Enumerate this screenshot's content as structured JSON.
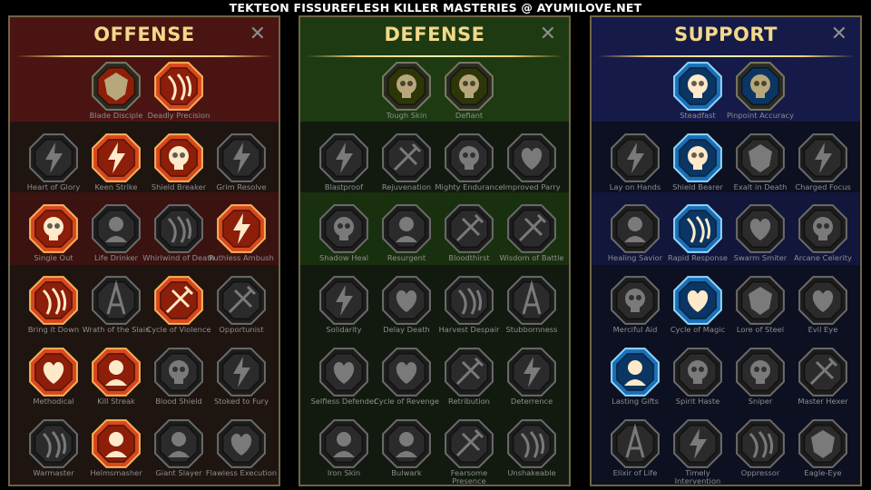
{
  "banner": "TEKTEON FISSUREFLESH KILLER MASTERIES @ AYUMILOVE.NET",
  "close_glyph": "✕",
  "panels": [
    {
      "title": "OFFENSE",
      "theme": {
        "bg_dark": "#1e1410",
        "band": "#4a1412",
        "band2": "#3a1210",
        "lit_fill": "#d9471c",
        "lit_inner": "#8c1e0a",
        "lit_ring": "#f7b25a"
      },
      "rows": [
        [
          {
            "label": "Blade Disciple",
            "icon": "crossed-swords-icon",
            "state": "half"
          },
          {
            "label": "Deadly Precision",
            "icon": "dagger-icon",
            "state": "lit"
          }
        ],
        [
          {
            "label": "Heart of Glory",
            "icon": "horned-warrior-icon",
            "state": "off"
          },
          {
            "label": "Keen Strike",
            "icon": "claw-slash-icon",
            "state": "lit"
          },
          {
            "label": "Shield Breaker",
            "icon": "broken-shield-icon",
            "state": "lit"
          },
          {
            "label": "Grim Resolve",
            "icon": "dark-heart-icon",
            "state": "off"
          }
        ],
        [
          {
            "label": "Single Out",
            "icon": "pointing-hands-icon",
            "state": "lit"
          },
          {
            "label": "Life Drinker",
            "icon": "fanged-mouth-icon",
            "state": "off"
          },
          {
            "label": "Whirlwind of Death",
            "icon": "skull-whirl-icon",
            "state": "off"
          },
          {
            "label": "Ruthless Ambush",
            "icon": "fist-blade-icon",
            "state": "lit"
          }
        ],
        [
          {
            "label": "Bring it Down",
            "icon": "sword-down-icon",
            "state": "lit"
          },
          {
            "label": "Wrath of the Slain",
            "icon": "hammer-fist-icon",
            "state": "off"
          },
          {
            "label": "Cycle of Violence",
            "icon": "axe-icon",
            "state": "lit"
          },
          {
            "label": "Opportunist",
            "icon": "chain-lightning-icon",
            "state": "off"
          }
        ],
        [
          {
            "label": "Methodical",
            "icon": "burst-icon",
            "state": "lit"
          },
          {
            "label": "Kill Streak",
            "icon": "skull-icon",
            "state": "lit"
          },
          {
            "label": "Blood Shield",
            "icon": "sword-shield-icon",
            "state": "off"
          },
          {
            "label": "Stoked to Fury",
            "icon": "raging-figure-icon",
            "state": "off"
          }
        ],
        [
          {
            "label": "Warmaster",
            "icon": "sword-star-icon",
            "state": "off"
          },
          {
            "label": "Helmsmasher",
            "icon": "helmet-icon",
            "state": "lit"
          },
          {
            "label": "Giant Slayer",
            "icon": "giant-icon",
            "state": "off"
          },
          {
            "label": "Flawless Execution",
            "icon": "execution-icon",
            "state": "off"
          }
        ]
      ]
    },
    {
      "title": "DEFENSE",
      "theme": {
        "bg_dark": "#121a10",
        "band": "#1d3a12",
        "band2": "#19300f",
        "lit_fill": "#6a7a14",
        "lit_inner": "#2c3608",
        "lit_ring": "#c5d24a"
      },
      "rows": [
        [
          {
            "label": "Tough Skin",
            "icon": "scales-icon",
            "state": "half"
          },
          {
            "label": "Defiant",
            "icon": "raised-fist-icon",
            "state": "half"
          }
        ],
        [
          {
            "label": "Blastproof",
            "icon": "armor-icon",
            "state": "off"
          },
          {
            "label": "Rejuvenation",
            "icon": "hand-heal-icon",
            "state": "off"
          },
          {
            "label": "Mighty Endurance",
            "icon": "muscle-icon",
            "state": "off"
          },
          {
            "label": "Improved Parry",
            "icon": "parry-blades-icon",
            "state": "off"
          }
        ],
        [
          {
            "label": "Shadow Heal",
            "icon": "shadow-figure-icon",
            "state": "off"
          },
          {
            "label": "Resurgent",
            "icon": "knight-icon",
            "state": "off"
          },
          {
            "label": "Bloodthirst",
            "icon": "skull-heart-icon",
            "state": "off"
          },
          {
            "label": "Wisdom of Battle",
            "icon": "hooded-sage-icon",
            "state": "off"
          }
        ],
        [
          {
            "label": "Solidarity",
            "icon": "raised-hands-icon",
            "state": "off"
          },
          {
            "label": "Delay Death",
            "icon": "hourglass-icon",
            "state": "off"
          },
          {
            "label": "Harvest Despair",
            "icon": "open-hand-icon",
            "state": "off"
          },
          {
            "label": "Stubbornness",
            "icon": "bull-icon",
            "state": "off"
          }
        ],
        [
          {
            "label": "Selfless Defender",
            "icon": "runner-icon",
            "state": "off"
          },
          {
            "label": "Cycle of Revenge",
            "icon": "flames-icon",
            "state": "off"
          },
          {
            "label": "Retribution",
            "icon": "spiked-skull-icon",
            "state": "off"
          },
          {
            "label": "Deterrence",
            "icon": "deflect-icon",
            "state": "off"
          }
        ],
        [
          {
            "label": "Iron Skin",
            "icon": "iron-warrior-icon",
            "state": "off"
          },
          {
            "label": "Bulwark",
            "icon": "tower-shield-icon",
            "state": "off"
          },
          {
            "label": "Fearsome Presence",
            "icon": "demon-mask-icon",
            "state": "off"
          },
          {
            "label": "Unshakeable",
            "icon": "strong-figure-icon",
            "state": "off"
          }
        ]
      ]
    },
    {
      "title": "SUPPORT",
      "theme": {
        "bg_dark": "#0c1020",
        "band": "#151a48",
        "band2": "#12163a",
        "lit_fill": "#1a6fb8",
        "lit_inner": "#0b3562",
        "lit_ring": "#8fd8ff"
      },
      "rows": [
        [
          {
            "label": "Steadfast",
            "icon": "heart-plus-icon",
            "state": "lit"
          },
          {
            "label": "Pinpoint Accuracy",
            "icon": "target-icon",
            "state": "half"
          }
        ],
        [
          {
            "label": "Lay on Hands",
            "icon": "praying-hands-icon",
            "state": "off"
          },
          {
            "label": "Shield Bearer",
            "icon": "glowing-shield-icon",
            "state": "lit"
          },
          {
            "label": "Exalt in Death",
            "icon": "smoking-skull-icon",
            "state": "off"
          },
          {
            "label": "Charged Focus",
            "icon": "charged-arm-icon",
            "state": "off"
          }
        ],
        [
          {
            "label": "Healing Savior",
            "icon": "savior-figure-icon",
            "state": "off"
          },
          {
            "label": "Rapid Response",
            "icon": "lightning-icon",
            "state": "lit"
          },
          {
            "label": "Swarm Smiter",
            "icon": "swarm-icon",
            "state": "off"
          },
          {
            "label": "Arcane Celerity",
            "icon": "dashing-figure-icon",
            "state": "off"
          }
        ],
        [
          {
            "label": "Merciful Aid",
            "icon": "chained-heart-icon",
            "state": "off"
          },
          {
            "label": "Cycle of Magic",
            "icon": "comet-icon",
            "state": "lit"
          },
          {
            "label": "Lore of Steel",
            "icon": "open-book-icon",
            "state": "off"
          },
          {
            "label": "Evil Eye",
            "icon": "sunburst-eye-icon",
            "state": "off"
          }
        ],
        [
          {
            "label": "Lasting Gifts",
            "icon": "compass-star-icon",
            "state": "lit"
          },
          {
            "label": "Spirit Haste",
            "icon": "winged-foot-icon",
            "state": "off"
          },
          {
            "label": "Sniper",
            "icon": "eye-icon",
            "state": "off"
          },
          {
            "label": "Master Hexer",
            "icon": "hex-figure-icon",
            "state": "off"
          }
        ],
        [
          {
            "label": "Elixir of Life",
            "icon": "potion-icon",
            "state": "off"
          },
          {
            "label": "Timely Intervention",
            "icon": "skull-crown-icon",
            "state": "off"
          },
          {
            "label": "Oppressor",
            "icon": "gauntlet-icon",
            "state": "off"
          },
          {
            "label": "Eagle-Eye",
            "icon": "eagle-icon",
            "state": "off"
          }
        ]
      ]
    }
  ]
}
